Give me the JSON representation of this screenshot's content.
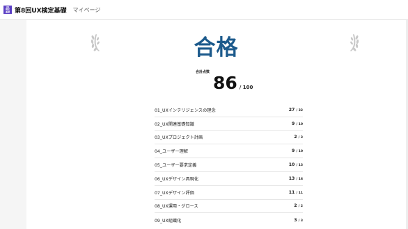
{
  "header": {
    "logo_lines": [
      "UX",
      "検定",
      "基礎"
    ],
    "title": "第8回UX検定基礎",
    "nav_mypage": "マイページ"
  },
  "result": {
    "status": "合格",
    "score_caption": "合計点数",
    "score": "86",
    "max": "/ 100"
  },
  "sections": [
    {
      "name": "01_UXインテリジェンスの理念",
      "score": "27",
      "max": "/ 32"
    },
    {
      "name": "02_UX関連基礎知識",
      "score": "9",
      "max": "/ 10"
    },
    {
      "name": "03_UXプロジェクト計画",
      "score": "2",
      "max": "/ 3"
    },
    {
      "name": "04_ユーザー理解",
      "score": "9",
      "max": "/ 10"
    },
    {
      "name": "05_ユーザー要求定義",
      "score": "10",
      "max": "/ 13"
    },
    {
      "name": "06_UXデザイン具現化",
      "score": "13",
      "max": "/ 16"
    },
    {
      "name": "07_UXデザイン評価",
      "score": "11",
      "max": "/ 11"
    },
    {
      "name": "08_UX運用・グロース",
      "score": "2",
      "max": "/ 2"
    },
    {
      "name": "09_UX組織化",
      "score": "3",
      "max": "/ 3"
    }
  ],
  "colors": {
    "accent": "#1c5a8c",
    "logo": "#5b3fc4",
    "laurel": "#c8c8c8"
  },
  "icons": {
    "laurel_left": "laurel-left-icon",
    "laurel_right": "laurel-right-icon"
  }
}
